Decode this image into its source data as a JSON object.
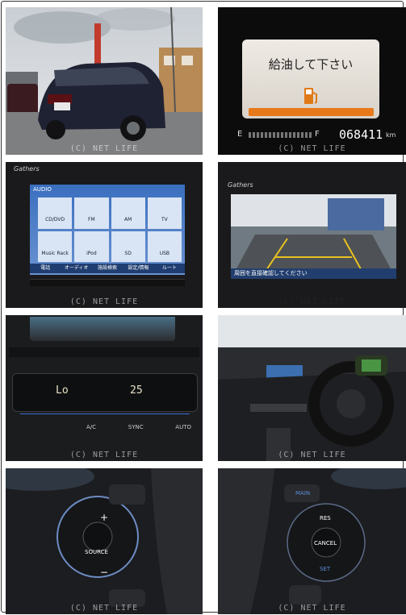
{
  "watermark": "(C) NET LIFE",
  "fuel_screen": {
    "message": "給油して下さい",
    "gauge_empty": "E",
    "gauge_full": "F",
    "odometer": "068411",
    "unit": "km"
  },
  "nav_brand": "Gathers",
  "audio_menu": {
    "header": "AUDIO",
    "sources": [
      "CD/DVD",
      "FM",
      "AM",
      "TV",
      "Music Rack",
      "iPod",
      "SD",
      "USB"
    ],
    "bottom_tabs": [
      "電話",
      "オーディオ",
      "施設検索",
      "設定/情報",
      "ルート"
    ]
  },
  "camera_warning": "周囲を直接確認してください",
  "climate": {
    "left_temp": "Lo",
    "right_temp": "25",
    "buttons": [
      "A/C",
      "SYNC",
      "AUTO"
    ]
  },
  "steering_left": {
    "center": "SOURCE",
    "plus": "+",
    "minus": "−"
  },
  "steering_right": {
    "top": "MAIN",
    "res": "RES",
    "center": "CANCEL",
    "set": "SET"
  }
}
